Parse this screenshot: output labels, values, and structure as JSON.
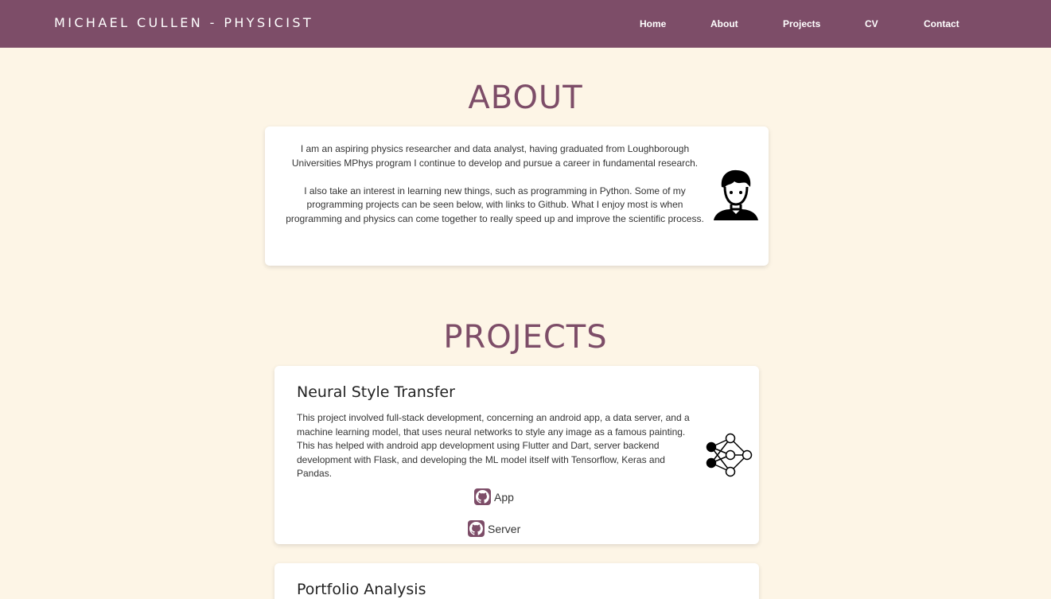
{
  "header": {
    "brand": "MICHAEL CULLEN - PHYSICIST",
    "nav": [
      {
        "label": "Home"
      },
      {
        "label": "About"
      },
      {
        "label": "Projects"
      },
      {
        "label": "CV"
      },
      {
        "label": "Contact"
      }
    ]
  },
  "about": {
    "title": "ABOUT",
    "paragraph1": "I am an aspiring physics researcher and data analyst, having graduated from Loughborough Universities MPhys program I continue to develop and pursue a career in fundamental research.",
    "paragraph2": "I also take an interest in learning new things, such as programming in Python. Some of my programming projects can be seen below, with links to Github. What I enjoy most is when programming and physics can come together to really speed up and improve the scientific process.",
    "avatar_icon": "user-avatar-icon"
  },
  "projects": {
    "title": "PROJECTS",
    "items": [
      {
        "title": "Neural Style Transfer",
        "description": "This project involved full-stack development, concerning an android app, a data server, and a machine learning model, that uses neural networks to style any image as a famous painting. This has helped with android app development using Flutter and Dart, server backend development with Flask, and developing the ML model itself with Tensorflow, Keras and Pandas.",
        "icon": "neural-network-icon",
        "links": [
          {
            "label": "App",
            "icon": "github-icon"
          },
          {
            "label": "Server",
            "icon": "github-icon"
          }
        ]
      },
      {
        "title": "Portfolio Analysis"
      }
    ]
  },
  "colors": {
    "brand": "#7d4d68",
    "background": "#fdf5e6",
    "card": "#ffffff"
  }
}
